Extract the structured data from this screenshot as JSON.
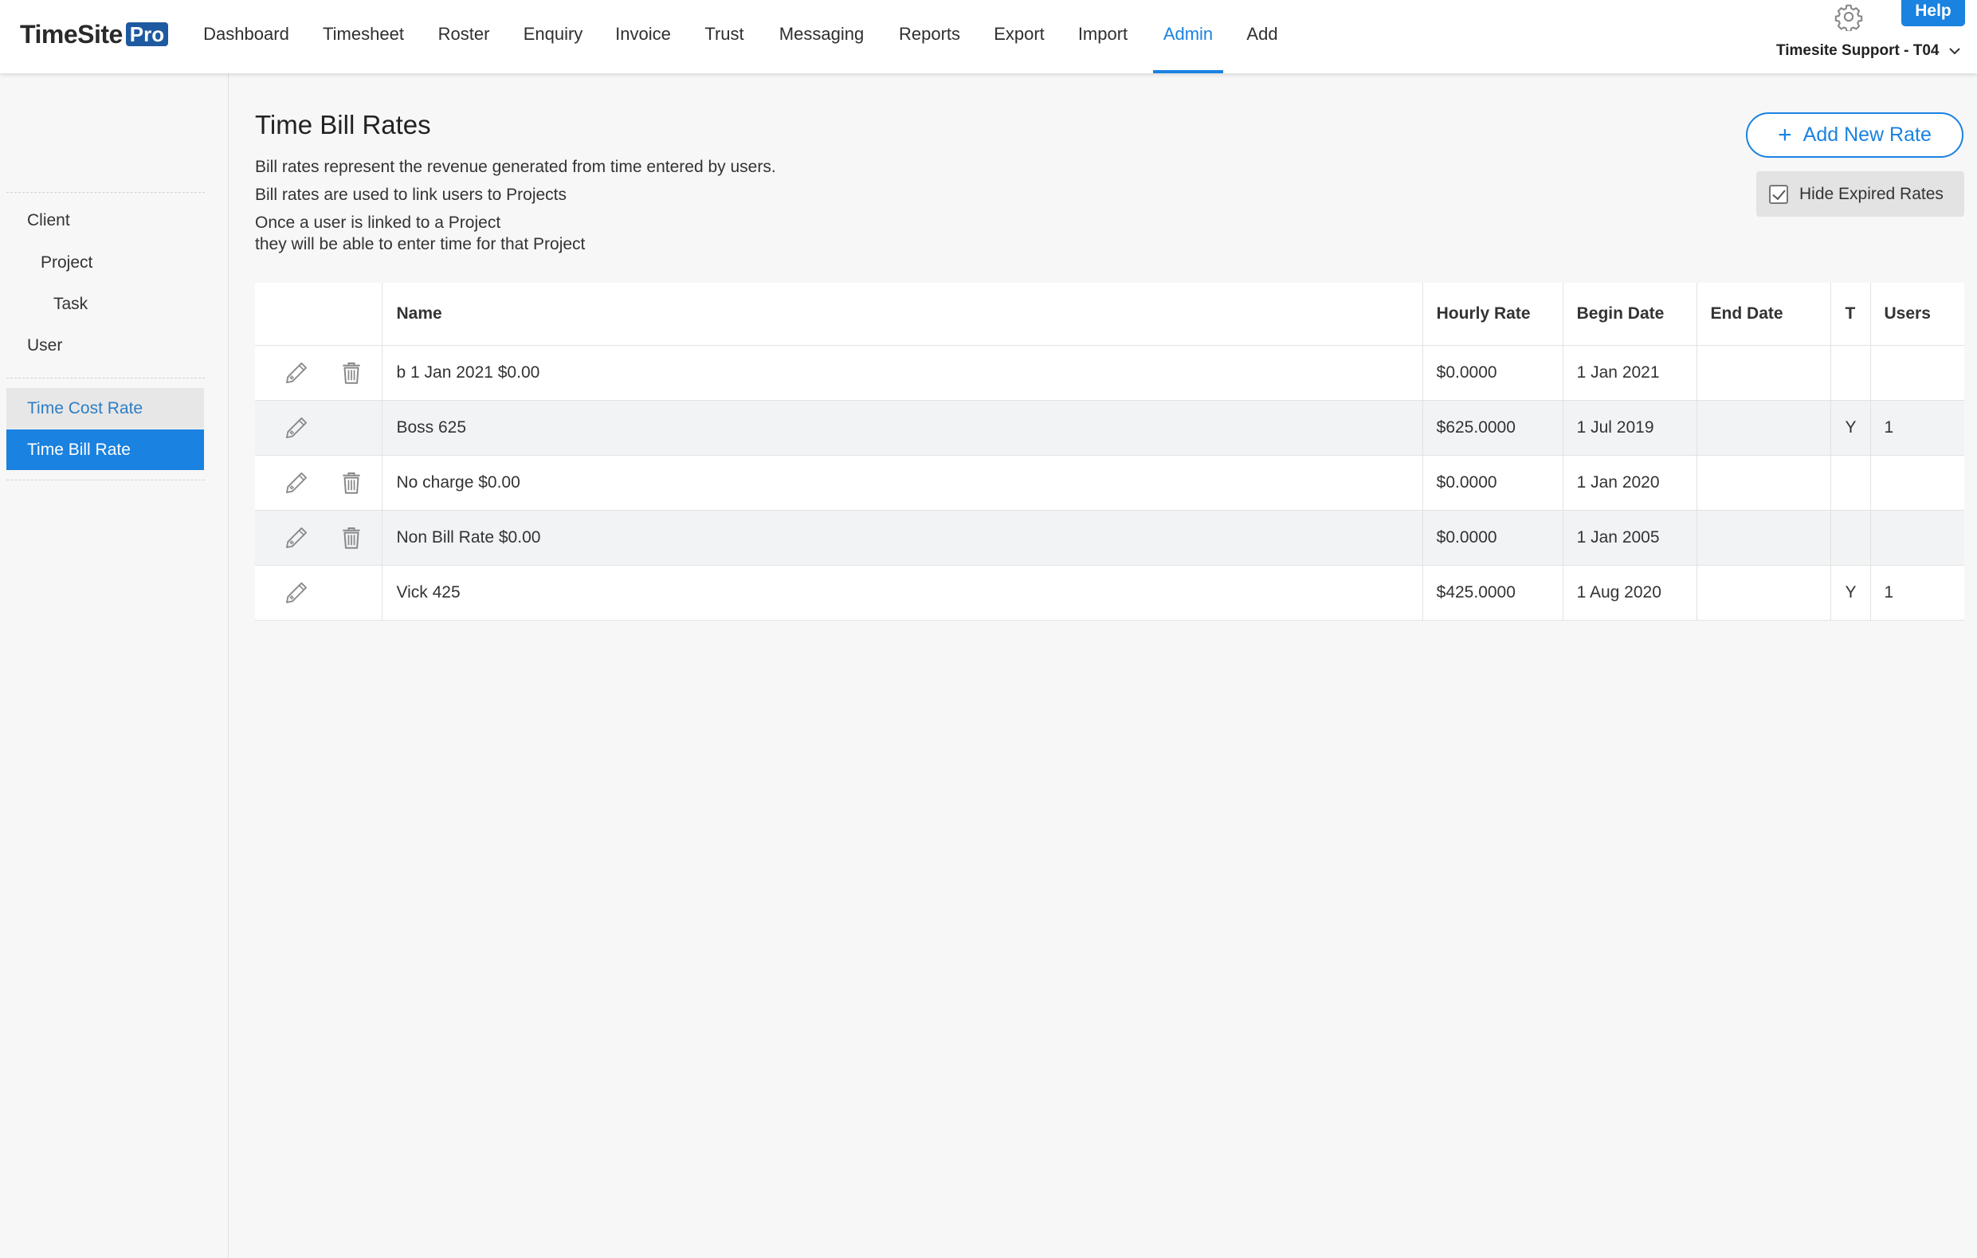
{
  "app": {
    "logo_main": "TimeSite",
    "logo_badge": "Pro",
    "accent_color": "#1a82e0"
  },
  "nav": {
    "items": [
      {
        "label": "Dashboard"
      },
      {
        "label": "Timesheet"
      },
      {
        "label": "Roster"
      },
      {
        "label": "Enquiry"
      },
      {
        "label": "Invoice"
      },
      {
        "label": "Trust"
      },
      {
        "label": "Messaging"
      },
      {
        "label": "Reports"
      },
      {
        "label": "Export"
      },
      {
        "label": "Import"
      },
      {
        "label": "Admin"
      },
      {
        "label": "Add"
      }
    ],
    "active": "Admin",
    "help_label": "Help",
    "user_label": "Timesite Support - T04",
    "settings_icon": "gear-icon",
    "user_dropdown_icon": "chevron-down-icon"
  },
  "sidebar": {
    "tree": [
      {
        "label": "Client"
      },
      {
        "label": "Project"
      },
      {
        "label": "Task"
      },
      {
        "label": "User"
      }
    ],
    "rates": [
      {
        "label": "Time Cost Rate",
        "selected": false
      },
      {
        "label": "Time Bill Rate",
        "selected": true
      }
    ]
  },
  "page": {
    "title": "Time Bill Rates",
    "desc": [
      "Bill rates represent the revenue generated from time entered by users.",
      "Bill rates are used to link users to Projects",
      "Once a user is linked to a Project",
      "they will be able to enter time for that Project"
    ],
    "add_button": "Add New Rate",
    "hide_expired": {
      "label": "Hide Expired Rates",
      "checked": true
    }
  },
  "table": {
    "headers": [
      "",
      "Name",
      "Hourly Rate",
      "Begin Date",
      "End Date",
      "T",
      "Users"
    ],
    "rows": [
      {
        "name": "b 1 Jan 2021 $0.00",
        "hourly_rate": "$0.0000",
        "begin_date": "1 Jan 2021",
        "end_date": "",
        "t": "",
        "users": "",
        "deletable": true
      },
      {
        "name": "Boss 625",
        "hourly_rate": "$625.0000",
        "begin_date": "1 Jul 2019",
        "end_date": "",
        "t": "Y",
        "users": "1",
        "deletable": false
      },
      {
        "name": "No charge $0.00",
        "hourly_rate": "$0.0000",
        "begin_date": "1 Jan 2020",
        "end_date": "",
        "t": "",
        "users": "",
        "deletable": true
      },
      {
        "name": "Non Bill Rate $0.00",
        "hourly_rate": "$0.0000",
        "begin_date": "1 Jan 2005",
        "end_date": "",
        "t": "",
        "users": "",
        "deletable": true
      },
      {
        "name": "Vick 425",
        "hourly_rate": "$425.0000",
        "begin_date": "1 Aug 2020",
        "end_date": "",
        "t": "Y",
        "users": "1",
        "deletable": false
      }
    ]
  }
}
